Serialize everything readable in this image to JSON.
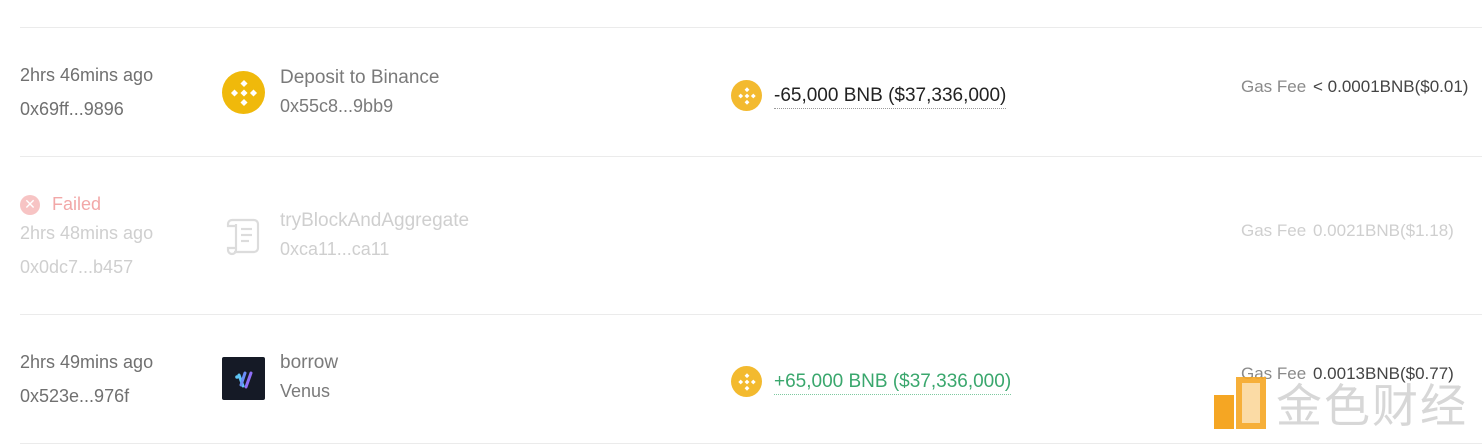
{
  "transactions": [
    {
      "time": "2hrs 46mins ago",
      "hash": "0x69ff...9896",
      "name": "Deposit to Binance",
      "address": "0x55c8...9bb9",
      "amount": "-65,000 BNB ($37,336,000)",
      "gas_label": "Gas Fee",
      "gas_value": "< 0.0001BNB($0.01)",
      "icon": "binance-logo-icon",
      "coin_icon": "bnb-coin-icon"
    },
    {
      "status": "Failed",
      "time": "2hrs 48mins ago",
      "hash": "0x0dc7...b457",
      "name": "tryBlockAndAggregate",
      "address": "0xca11...ca11",
      "gas_label": "Gas Fee",
      "gas_value": "0.0021BNB($1.18)",
      "icon": "contract-scroll-icon"
    },
    {
      "time": "2hrs 49mins ago",
      "hash": "0x523e...976f",
      "name": "borrow",
      "address": "Venus",
      "amount": "+65,000 BNB ($37,336,000)",
      "gas_label": "Gas Fee",
      "gas_value": "0.0013BNB($0.77)",
      "icon": "venus-logo-icon",
      "coin_icon": "bnb-coin-icon"
    }
  ],
  "watermark": {
    "text": "金色财经"
  },
  "colors": {
    "bnb": "#f0b90b",
    "positive": "#3aa76d",
    "failed": "#f2a8a8"
  }
}
